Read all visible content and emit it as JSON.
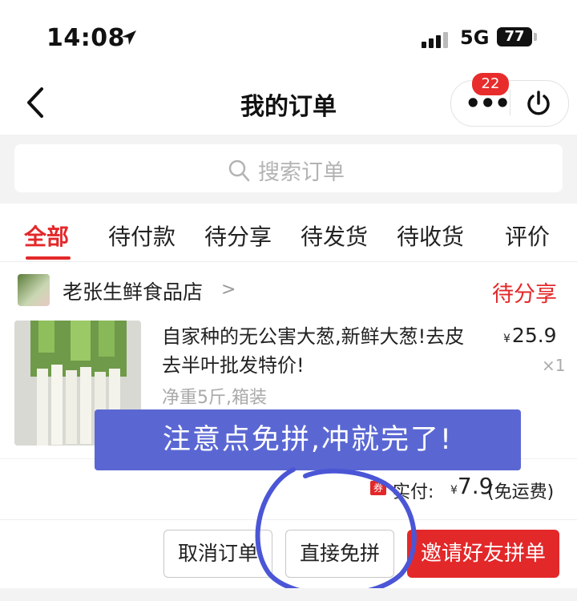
{
  "status_bar": {
    "time": "14:08",
    "network": "5G",
    "battery": "77"
  },
  "header": {
    "title": "我的订单",
    "notification_count": "22"
  },
  "search": {
    "placeholder": "搜索订单"
  },
  "tabs": [
    {
      "label": "全部",
      "active": true
    },
    {
      "label": "待付款"
    },
    {
      "label": "待分享"
    },
    {
      "label": "待发货"
    },
    {
      "label": "待收货"
    },
    {
      "label": "评价"
    }
  ],
  "order": {
    "store_name": "老张生鲜食品店",
    "status": "待分享",
    "product": {
      "title": "自家种的无公害大葱,新鲜大葱!去皮去半叶批发特价!",
      "spec": "净重5斤,箱装",
      "currency": "¥",
      "price": "25.9",
      "quantity": "×1"
    },
    "coupon_label": "券",
    "paid_label": "实付:",
    "paid_currency": "¥",
    "paid_amount": "7.9",
    "shipping_note": "(免运费)"
  },
  "overlay": {
    "note": "注意点免拼,冲就完了!"
  },
  "buttons": {
    "cancel": "取消订单",
    "direct": "直接免拼",
    "invite": "邀请好友拼单"
  },
  "colors": {
    "accent": "#e3282a",
    "overlay": "#5a67d3"
  }
}
